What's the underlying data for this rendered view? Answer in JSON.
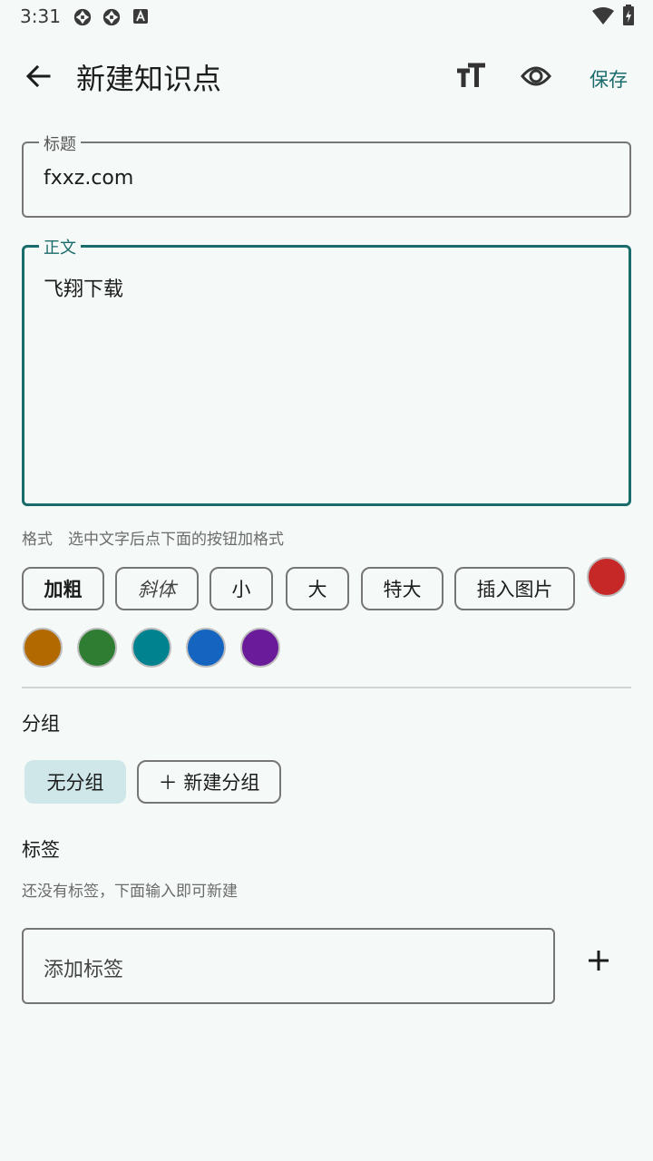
{
  "status": {
    "time": "3:31"
  },
  "appbar": {
    "title": "新建知识点",
    "save_label": "保存"
  },
  "title_field": {
    "label": "标题",
    "value": "fxxz.com"
  },
  "body_field": {
    "label": "正文",
    "value": "飞翔下载"
  },
  "format": {
    "label": "格式",
    "hint": "选中文字后点下面的按钮加格式",
    "buttons": [
      "加粗",
      "斜体",
      "小",
      "大",
      "特大",
      "插入图片"
    ],
    "colors": [
      "#c62828",
      "#b26a00",
      "#2e7d32",
      "#00838f",
      "#1565c0",
      "#6a1b9a"
    ]
  },
  "group": {
    "label": "分组",
    "selected_chip": "无分组",
    "new_chip": "＋ 新建分组"
  },
  "tags": {
    "label": "标签",
    "hint": "还没有标签，下面输入即可新建",
    "input_placeholder": "添加标签"
  },
  "colors": {
    "accent": "#1a6b6b",
    "chip_selected_bg": "#cfe7e8",
    "background": "#f5f9f8"
  }
}
